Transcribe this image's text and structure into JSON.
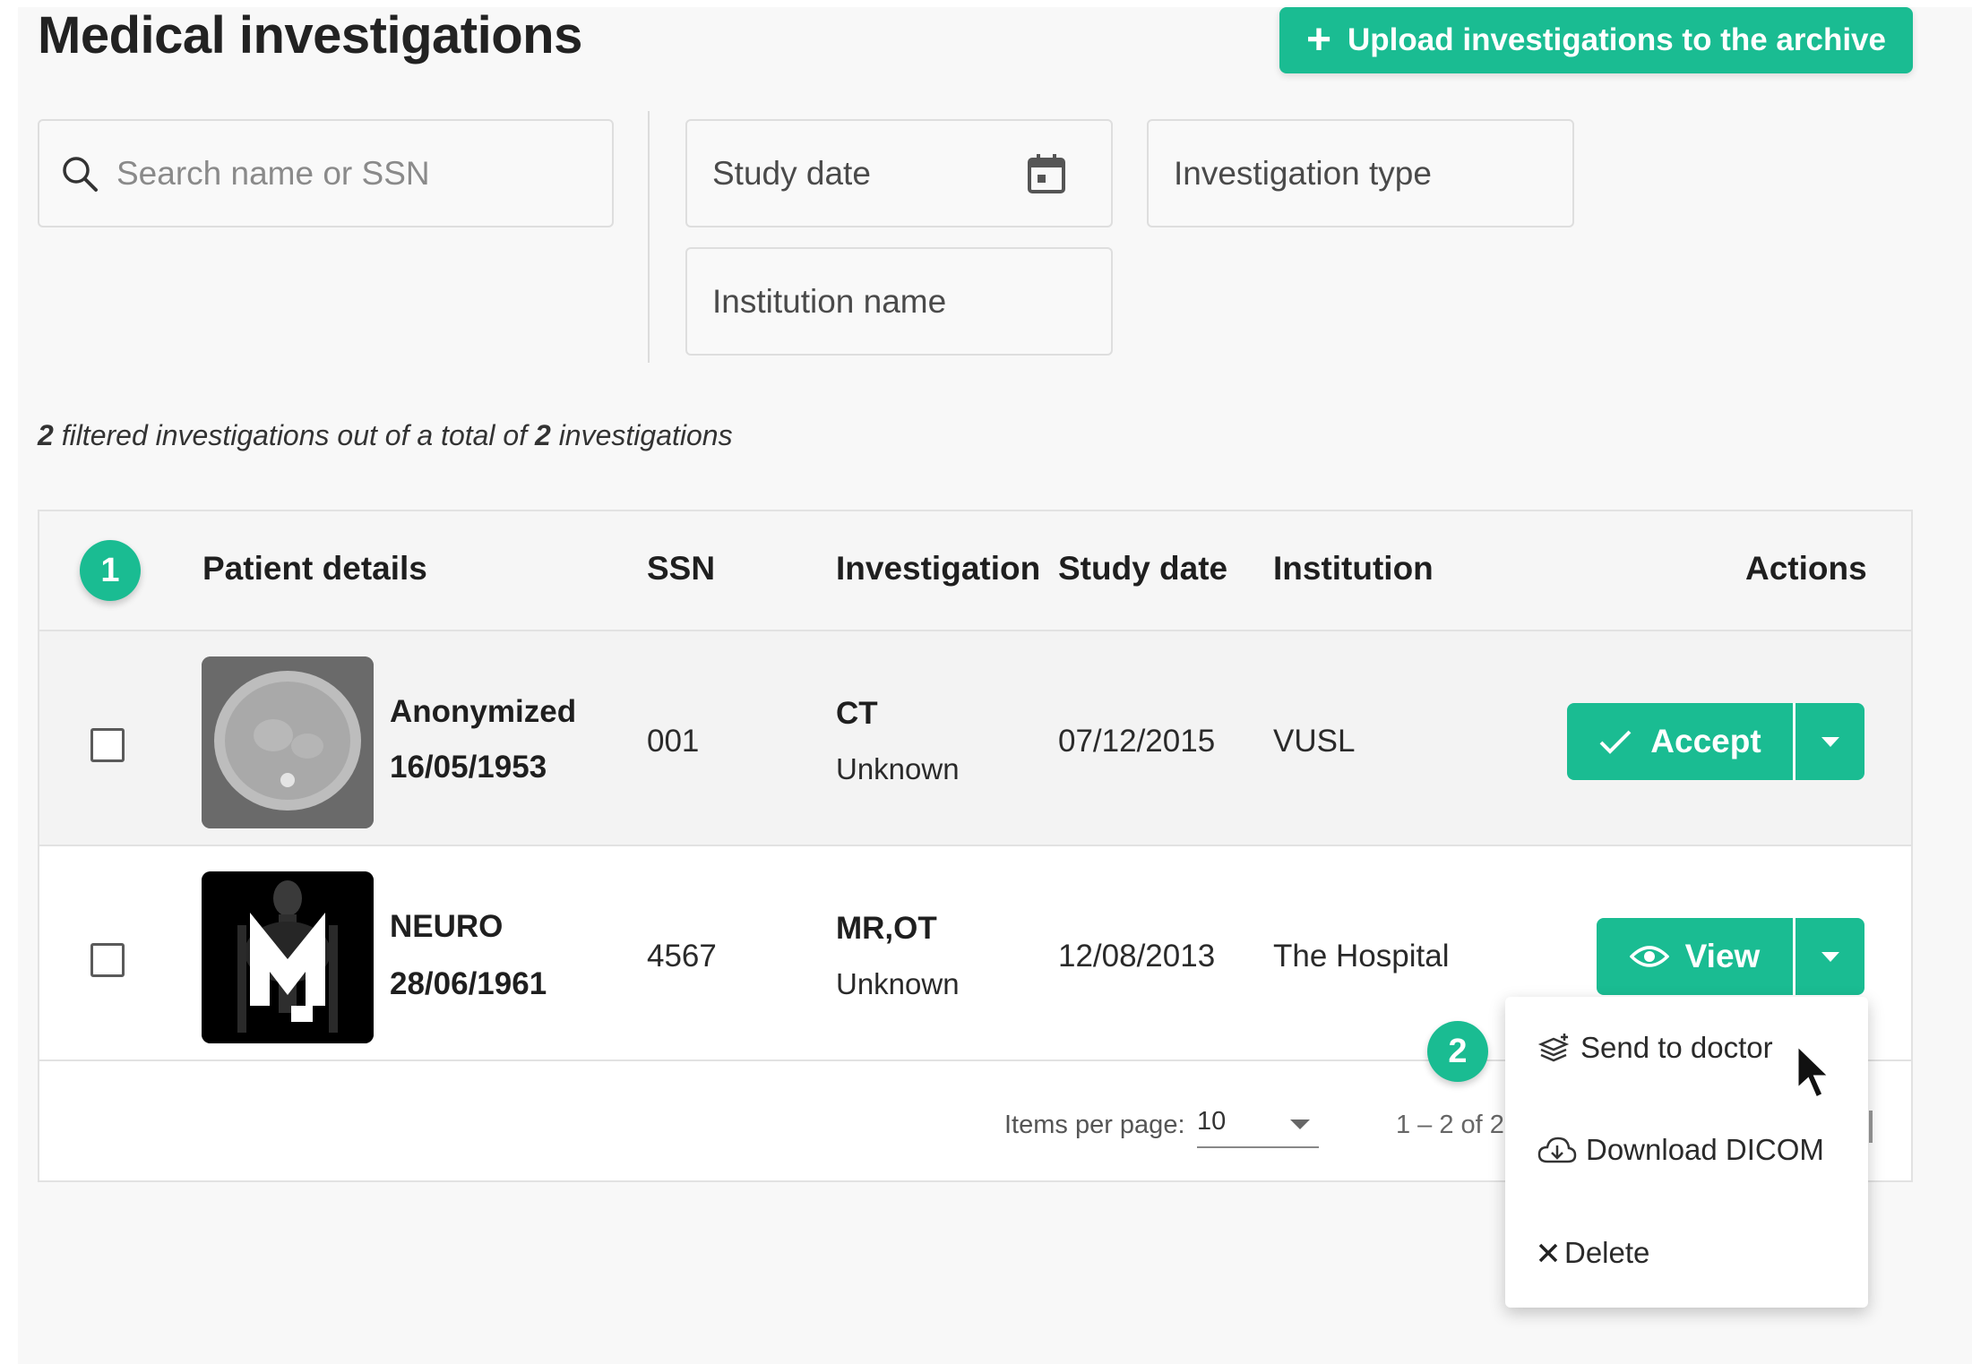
{
  "header": {
    "title": "Medical investigations",
    "upload_label": "Upload investigations to the archive"
  },
  "filters": {
    "search_placeholder": "Search name or SSN",
    "study_date_label": "Study date",
    "investigation_type_label": "Investigation type",
    "institution_name_label": "Institution name"
  },
  "summary": {
    "filtered_count": "2",
    "text_mid": " filtered investigations out of a total of ",
    "total_count": "2",
    "text_end": " investigations"
  },
  "annotations": {
    "badge_1": "1",
    "badge_2": "2"
  },
  "table": {
    "columns": [
      "Patient details",
      "SSN",
      "Investigation",
      "Study date",
      "Institution",
      "Actions"
    ],
    "rows": [
      {
        "name": "Anonymized",
        "dob": "16/05/1953",
        "ssn": "001",
        "modality": "CT",
        "investigation_type": "Unknown",
        "study_date": "07/12/2015",
        "institution": "VUSL",
        "action": "Accept"
      },
      {
        "name": "NEURO",
        "dob": "28/06/1961",
        "ssn": "4567",
        "modality": "MR,OT",
        "investigation_type": "Unknown",
        "study_date": "12/08/2013",
        "institution": "The Hospital",
        "action": "View"
      }
    ]
  },
  "paginator": {
    "items_per_page_label": "Items per page:",
    "items_per_page_value": "10",
    "range_label": "1 – 2 of 2"
  },
  "menu": {
    "items": [
      "Send to doctor",
      "Download DICOM",
      "Delete"
    ]
  },
  "colors": {
    "accent": "#1abc92"
  }
}
